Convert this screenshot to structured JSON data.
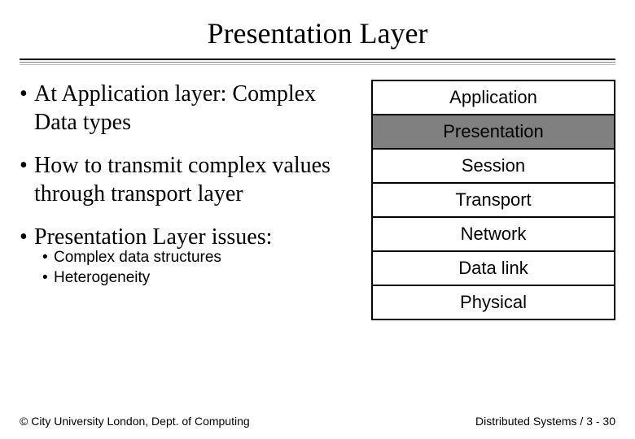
{
  "title": "Presentation Layer",
  "bullets": {
    "b1": "At Application layer: Complex Data types",
    "b2": "How to transmit complex values through transport layer",
    "b3": "Presentation Layer issues:"
  },
  "sub": {
    "s1": "Complex data structures",
    "s2": "Heterogeneity"
  },
  "layers": {
    "l1": "Application",
    "l2": "Presentation",
    "l3": "Session",
    "l4": "Transport",
    "l5": "Network",
    "l6": "Data link",
    "l7": "Physical"
  },
  "footer": {
    "left": "© City University London, Dept. of Computing",
    "right": "Distributed Systems / 3 - 30"
  }
}
